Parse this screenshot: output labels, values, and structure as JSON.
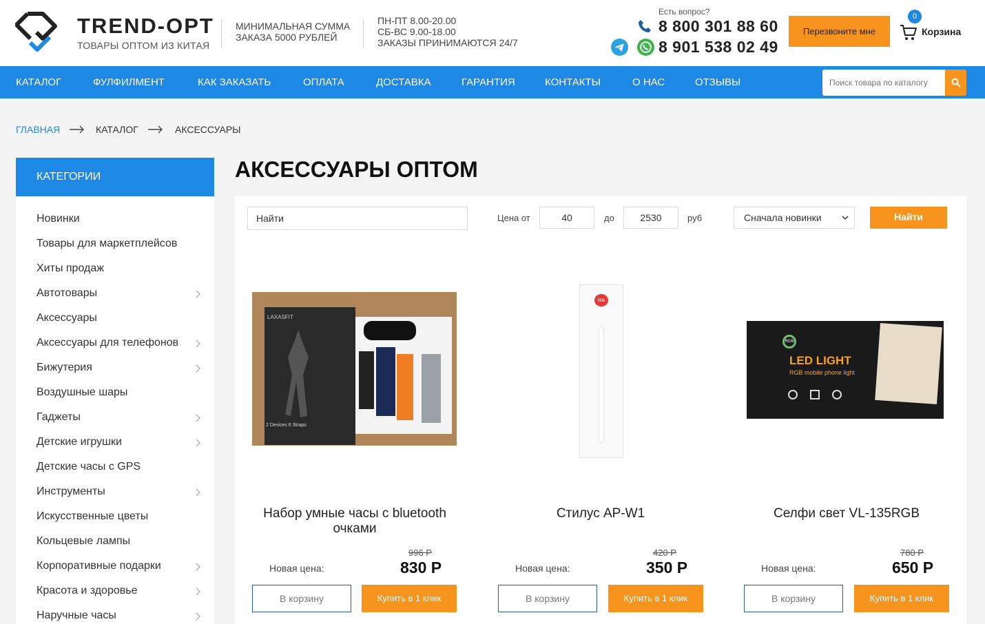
{
  "header": {
    "logo_title": "TREND-OPT",
    "logo_subtitle": "ТОВАРЫ ОПТОМ ИЗ КИТАЯ",
    "min_order_line1": "МИНИМАЛЬНАЯ СУММА",
    "min_order_line2": "ЗАКАЗА 5000 РУБЛЕЙ",
    "hours_line1": "ПН-ПТ 8.00-20.00",
    "hours_line2": "СБ-ВС 9.00-18.00",
    "hours_line3": "ЗАКАЗЫ ПРИНИМАЮТСЯ 24/7",
    "question": "Есть вопрос?",
    "phone1": "8 800 301 88 60",
    "phone2": "8 901 538 02 49",
    "callback_label": "Перезвоните мне",
    "cart_count": "0",
    "cart_label": "Корзина"
  },
  "nav": {
    "items": [
      "КАТАЛОГ",
      "ФУЛФИЛМЕНТ",
      "КАК ЗАКАЗАТЬ",
      "ОПЛАТА",
      "ДОСТАВКА",
      "ГАРАНТИЯ",
      "КОНТАКТЫ",
      "О НАС",
      "ОТЗЫВЫ"
    ],
    "search_placeholder": "Поиск товара по каталогу"
  },
  "breadcrumb": [
    "ГЛАВНАЯ",
    "КАТАЛОГ",
    "АКСЕССУАРЫ"
  ],
  "sidebar": {
    "heading": "КАТЕГОРИИ",
    "items": [
      {
        "label": "Новинки",
        "has_children": false
      },
      {
        "label": "Товары для маркетплейсов",
        "has_children": false
      },
      {
        "label": "Хиты продаж",
        "has_children": false
      },
      {
        "label": "Автотовары",
        "has_children": true
      },
      {
        "label": "Аксессуары",
        "has_children": false
      },
      {
        "label": "Аксессуары для телефонов",
        "has_children": true
      },
      {
        "label": "Бижутерия",
        "has_children": true
      },
      {
        "label": "Воздушные шары",
        "has_children": false
      },
      {
        "label": "Гаджеты",
        "has_children": true
      },
      {
        "label": "Детские игрушки",
        "has_children": true
      },
      {
        "label": "Детские часы с GPS",
        "has_children": false
      },
      {
        "label": "Инструменты",
        "has_children": true
      },
      {
        "label": "Искусственные цветы",
        "has_children": false
      },
      {
        "label": "Кольцевые лампы",
        "has_children": false
      },
      {
        "label": "Корпоративные подарки",
        "has_children": true
      },
      {
        "label": "Красота и здоровье",
        "has_children": true
      },
      {
        "label": "Наручные часы",
        "has_children": true
      }
    ]
  },
  "main": {
    "title": "АКСЕССУАРЫ ОПТОМ",
    "filter": {
      "search_value": "Найти",
      "price_from_label": "Цена от",
      "price_from": "40",
      "price_to_label": "до",
      "price_to": "2530",
      "currency": "руб",
      "sort_selected": "Сначала новинки",
      "submit_label": "Найти"
    },
    "products": [
      {
        "name": "Набор умные часы с bluetooth очками",
        "old_price": "996 Р",
        "new_price_label": "Новая цена:",
        "new_price": "830 Р",
        "cart_label": "В корзину",
        "buy_label": "Купить в 1 клик",
        "image_text": "LAXASFIT",
        "image_caption": "2 Devices 6 Straps"
      },
      {
        "name": "Стилус AP-W1",
        "old_price": "420 Р",
        "new_price_label": "Новая цена:",
        "new_price": "350 Р",
        "cart_label": "В корзину",
        "buy_label": "Купить в 1 клик",
        "image_text": "isa"
      },
      {
        "name": "Селфи свет VL-135RGB",
        "old_price": "780 Р",
        "new_price_label": "Новая цена:",
        "new_price": "650 Р",
        "cart_label": "В корзину",
        "buy_label": "Купить в 1 клик",
        "image_text": "LED LIGHT",
        "image_caption": "RGB mobile phone light",
        "image_badge": "RGB"
      }
    ]
  },
  "colors": {
    "brand_blue": "#1e88e5",
    "accent_orange": "#f7941d"
  }
}
